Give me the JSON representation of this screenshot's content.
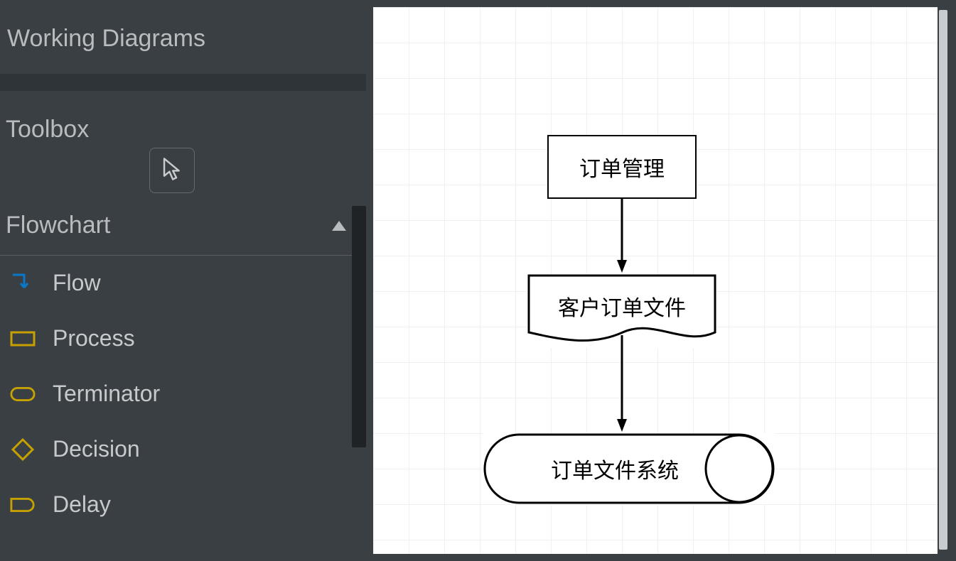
{
  "sidebar": {
    "title": "Working Diagrams",
    "toolbox_label": "Toolbox",
    "section_label": "Flowchart",
    "tools": [
      {
        "label": "Flow"
      },
      {
        "label": "Process"
      },
      {
        "label": "Terminator"
      },
      {
        "label": "Decision"
      },
      {
        "label": "Delay"
      }
    ]
  },
  "diagram": {
    "node1": "订单管理",
    "node2": "客户订单文件",
    "node3": "订单文件系统"
  }
}
